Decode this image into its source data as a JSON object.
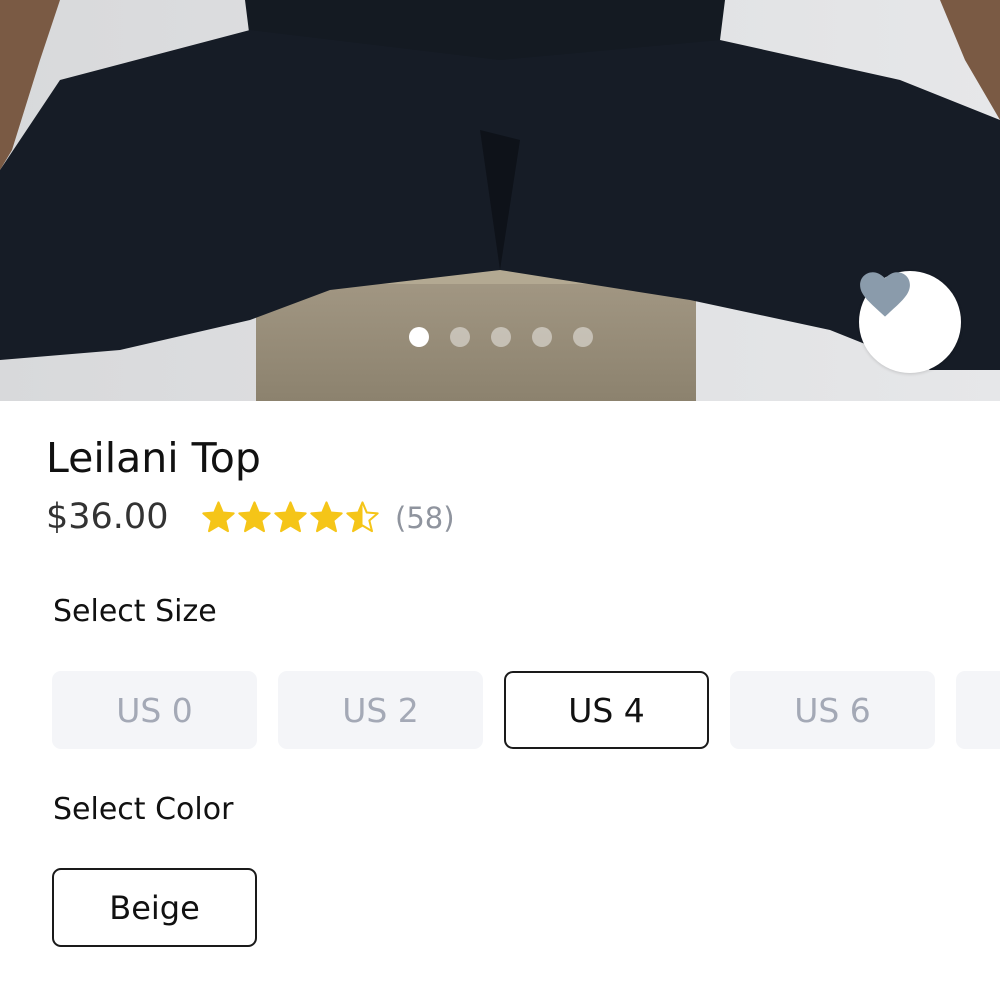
{
  "product": {
    "title": "Leilani Top",
    "price": "$36.00",
    "rating": 4.5,
    "rating_max": 5,
    "review_count": "(58)",
    "star_color": "#f5c518"
  },
  "gallery": {
    "image_count": 5,
    "active_index": 0,
    "favorite_icon": "heart-icon",
    "favorite_color": "#8a9bab"
  },
  "size_section": {
    "label": "Select Size",
    "options": [
      "US 0",
      "US 2",
      "US 4",
      "US 6",
      ""
    ],
    "selected": "US 4"
  },
  "color_section": {
    "label": "Select Color",
    "options": [
      "Beige"
    ]
  }
}
